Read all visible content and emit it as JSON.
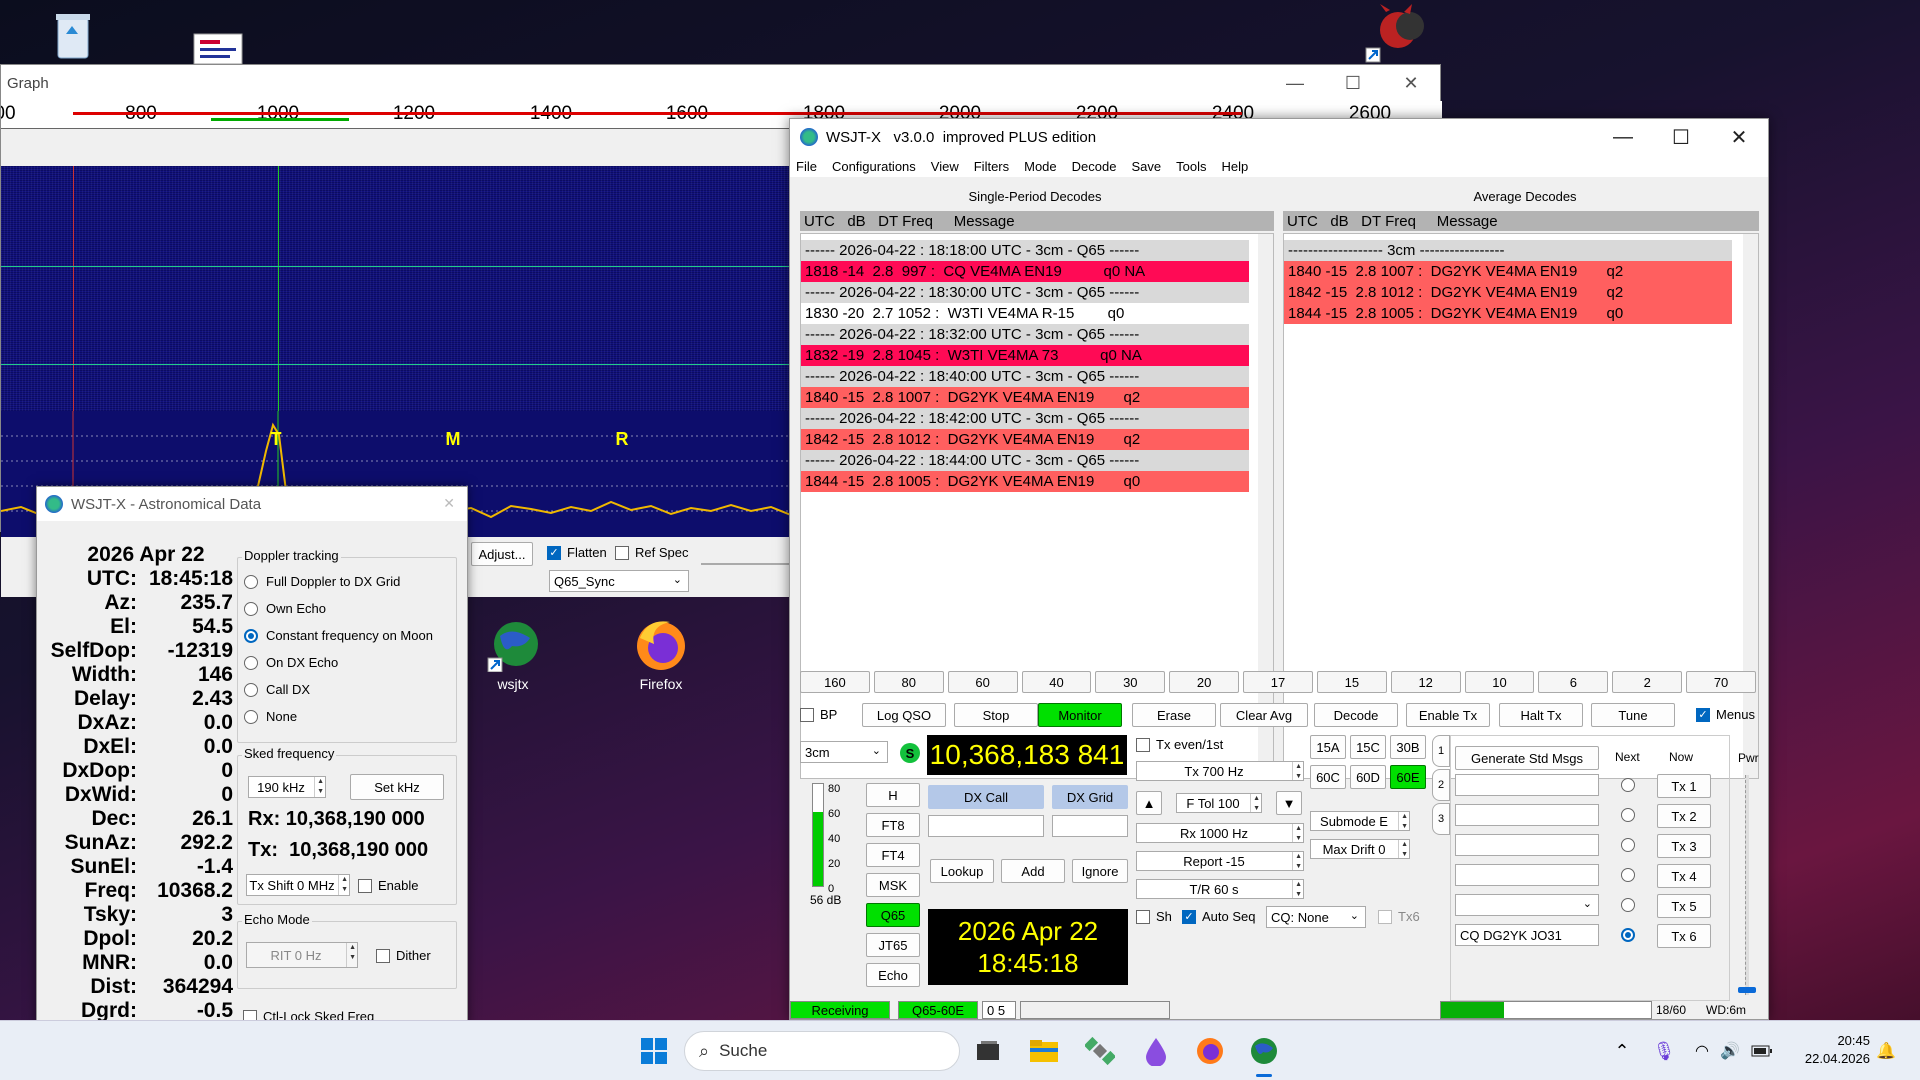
{
  "desktop": {
    "icons": [
      {
        "label": "wsjtx"
      },
      {
        "label": "Firefox"
      }
    ]
  },
  "wide_graph": {
    "title": "Graph",
    "freq_labels": [
      "00",
      "800",
      "1000",
      "1200",
      "1400",
      "1600",
      "1800",
      "2000",
      "2200",
      "2400",
      "2600"
    ],
    "markers": [
      "T",
      "M",
      "R"
    ],
    "adjust_label": "Adjust...",
    "flatten_label": "Flatten",
    "flatten_checked": true,
    "refspec_label": "Ref Spec",
    "refspec_checked": false,
    "mode_select": "Q65_Sync"
  },
  "main": {
    "title": "WSJT-X   v3.0.0  improved PLUS edition",
    "menu": [
      "File",
      "Configurations",
      "View",
      "Filters",
      "Mode",
      "Decode",
      "Save",
      "Tools",
      "Help"
    ],
    "single_title": "Single-Period Decodes",
    "average_title": "Average Decodes",
    "header": "UTC   dB   DT Freq     Message",
    "single_lines": [
      {
        "t": "------ 2026-04-22 : 18:18:00 UTC - 3cm - Q65 ------",
        "c": "#d9d9d9"
      },
      {
        "t": "1818 -14  2.8  997 :  CQ VE4MA EN19          q0 NA",
        "c": "#ff0a55"
      },
      {
        "t": "------ 2026-04-22 : 18:30:00 UTC - 3cm - Q65 ------",
        "c": "#d9d9d9"
      },
      {
        "t": "1830 -20  2.7 1052 :  W3TI VE4MA R-15        q0",
        "c": "#ffffff"
      },
      {
        "t": "------ 2026-04-22 : 18:32:00 UTC - 3cm - Q65 ------",
        "c": "#d9d9d9"
      },
      {
        "t": "1832 -19  2.8 1045 :  W3TI VE4MA 73          q0 NA",
        "c": "#ff0a55"
      },
      {
        "t": "------ 2026-04-22 : 18:40:00 UTC - 3cm - Q65 ------",
        "c": "#d9d9d9"
      },
      {
        "t": "1840 -15  2.8 1007 :  DG2YK VE4MA EN19       q2",
        "c": "#ff5f5f"
      },
      {
        "t": "------ 2026-04-22 : 18:42:00 UTC - 3cm - Q65 ------",
        "c": "#d9d9d9"
      },
      {
        "t": "1842 -15  2.8 1012 :  DG2YK VE4MA EN19       q2",
        "c": "#ff5f5f"
      },
      {
        "t": "------ 2026-04-22 : 18:44:00 UTC - 3cm - Q65 ------",
        "c": "#d9d9d9"
      },
      {
        "t": "1844 -15  2.8 1005 :  DG2YK VE4MA EN19       q0",
        "c": "#ff5f5f"
      }
    ],
    "average_lines": [
      {
        "t": "------------------- 3cm -----------------",
        "c": "#d9d9d9"
      },
      {
        "t": "1840 -15  2.8 1007 :  DG2YK VE4MA EN19       q2",
        "c": "#ff5f5f"
      },
      {
        "t": "1842 -15  2.8 1012 :  DG2YK VE4MA EN19       q2",
        "c": "#ff5f5f"
      },
      {
        "t": "1844 -15  2.8 1005 :  DG2YK VE4MA EN19       q0",
        "c": "#ff5f5f"
      }
    ],
    "bands": [
      "160",
      "80",
      "60",
      "40",
      "30",
      "20",
      "17",
      "15",
      "12",
      "10",
      "6",
      "2",
      "70"
    ],
    "bp_label": "BP",
    "buttons": {
      "logqso": "Log QSO",
      "stop": "Stop",
      "monitor": "Monitor",
      "erase": "Erase",
      "clearavg": "Clear Avg",
      "decode": "Decode",
      "enabletx": "Enable Tx",
      "halttx": "Halt Tx",
      "tune": "Tune"
    },
    "menus_label": "Menus",
    "band_select": "3cm",
    "s_label": "S",
    "dial_freq": "10,368,183 841",
    "txeven_label": "Tx even/1st",
    "submodes": [
      "15A",
      "15C",
      "30B",
      "60C",
      "60D",
      "60E"
    ],
    "tx_freq": "Tx  700  Hz",
    "ftol": "F Tol  100",
    "rx_freq": "Rx  1000  Hz",
    "report": "Report -15",
    "tr": "T/R  60  s",
    "submode": "Submode E",
    "maxdrift": "Max Drift  0",
    "modes": [
      "H",
      "FT8",
      "FT4",
      "MSK",
      "Q65",
      "JT65",
      "Echo"
    ],
    "meter_ticks": [
      "80",
      "60",
      "40",
      "20",
      "0"
    ],
    "meter_db": "56 dB",
    "dxcall_label": "DX Call",
    "dxgrid_label": "DX Grid",
    "lookup": "Lookup",
    "add": "Add",
    "ignore": "Ignore",
    "clock_date": "2026 Apr 22",
    "clock_time": "18:45:18",
    "sh_label": "Sh",
    "autoseq_label": "Auto Seq",
    "cq_select": "CQ: None",
    "tx6_label": "Tx6",
    "tabs": [
      "1",
      "2",
      "3"
    ],
    "gen_std": "Generate Std Msgs",
    "next_label": "Next",
    "now_label": "Now",
    "tx_buttons": [
      "Tx 1",
      "Tx 2",
      "Tx 3",
      "Tx 4",
      "Tx 5",
      "Tx 6"
    ],
    "tx6_msg": "CQ DG2YK JO31",
    "pwr_label": "Pwr",
    "status_receiving": "Receiving",
    "status_mode": "Q65-60E",
    "status_count": "0  5",
    "status_progress": "18/60",
    "status_wd": "WD:6m",
    "progress_fraction": 0.3
  },
  "astro": {
    "title": "WSJT-X - Astronomical Data",
    "date": "2026 Apr 22",
    "rows": [
      [
        "UTC:",
        "18:45:18"
      ],
      [
        "Az:",
        "235.7"
      ],
      [
        "El:",
        "54.5"
      ],
      [
        "SelfDop:",
        "-12319"
      ],
      [
        "Width:",
        "146"
      ],
      [
        "Delay:",
        "2.43"
      ],
      [
        "DxAz:",
        "0.0"
      ],
      [
        "DxEl:",
        "0.0"
      ],
      [
        "DxDop:",
        "0"
      ],
      [
        "DxWid:",
        "0"
      ],
      [
        "Dec:",
        "26.1"
      ],
      [
        "SunAz:",
        "292.2"
      ],
      [
        "SunEl:",
        "-1.4"
      ],
      [
        "Freq:",
        "10368.2"
      ],
      [
        "Tsky:",
        "3"
      ],
      [
        "Dpol:",
        "20.2"
      ],
      [
        "MNR:",
        "0.0"
      ],
      [
        "Dist:",
        "364294"
      ],
      [
        "Dgrd:",
        "-0.5"
      ]
    ],
    "doppler_title": "Doppler tracking",
    "doppler_options": [
      "Full Doppler to DX Grid",
      "Own Echo",
      "Constant frequency on Moon",
      "On DX Echo",
      "Call DX",
      "None"
    ],
    "doppler_selected": 2,
    "sked_title": "Sked frequency",
    "sked_khz": "190  kHz",
    "set_khz": "Set kHz",
    "rx_freq": "Rx: 10,368,190 000",
    "tx_freq": "Tx:  10,368,190 000",
    "txshift": "Tx Shift  0  MHz",
    "enable_label": "Enable",
    "echo_title": "Echo Mode",
    "rit": "RIT  0  Hz",
    "dither_label": "Dither",
    "ctllock_label": "Ctl-Lock Sked Freq"
  },
  "taskbar": {
    "search_label": "Suche",
    "time": "20:45",
    "date": "22.04.2026"
  }
}
